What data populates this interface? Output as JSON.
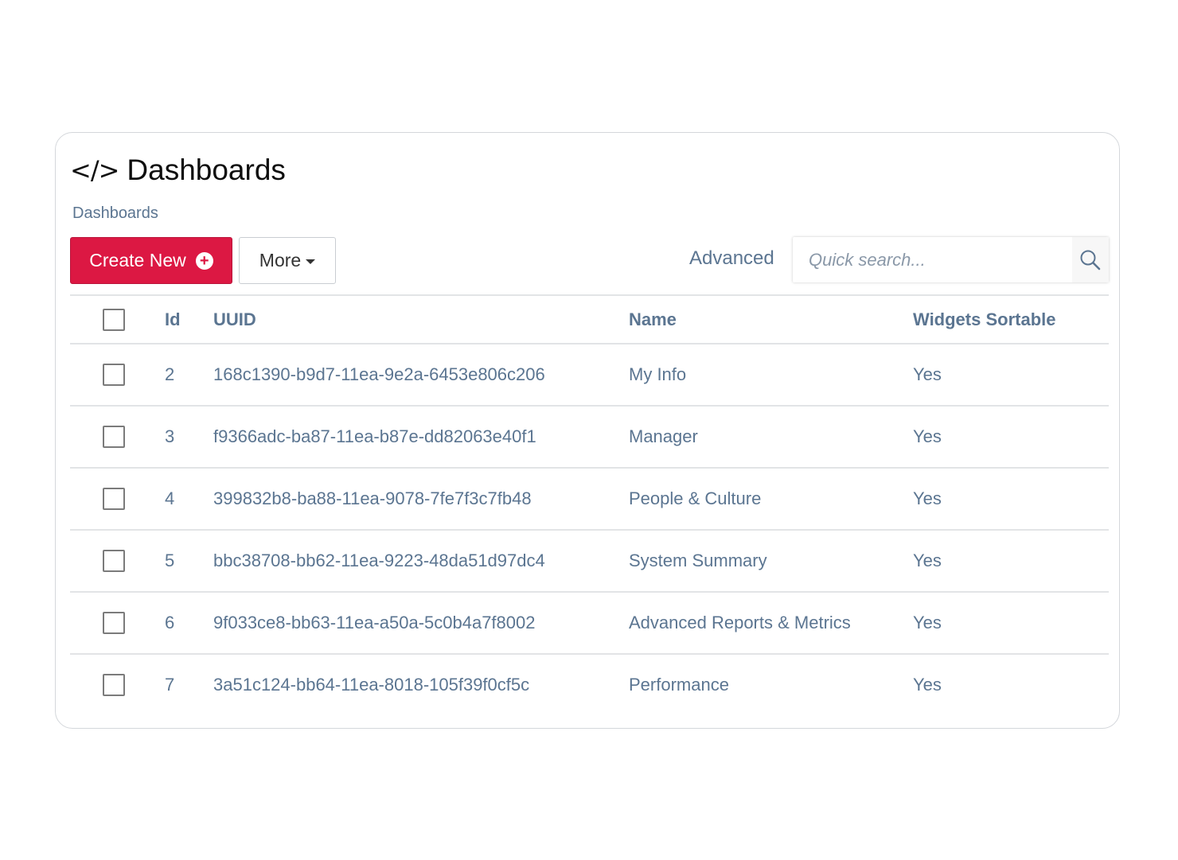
{
  "page": {
    "title": "Dashboards",
    "title_icon": "code-icon",
    "breadcrumb": "Dashboards"
  },
  "toolbar": {
    "create_label": "Create New",
    "create_icon": "plus-circle-icon",
    "more_label": "More",
    "advanced_label": "Advanced",
    "search_placeholder": "Quick search...",
    "search_value": ""
  },
  "colors": {
    "accent": "#dc1843",
    "text": "#5b7591"
  },
  "table": {
    "columns": [
      "Id",
      "UUID",
      "Name",
      "Widgets Sortable"
    ],
    "rows": [
      {
        "id": "2",
        "uuid": "168c1390-b9d7-11ea-9e2a-6453e806c206",
        "name": "My Info",
        "widgets_sortable": "Yes",
        "checked": false
      },
      {
        "id": "3",
        "uuid": "f9366adc-ba87-11ea-b87e-dd82063e40f1",
        "name": "Manager",
        "widgets_sortable": "Yes",
        "checked": false
      },
      {
        "id": "4",
        "uuid": "399832b8-ba88-11ea-9078-7fe7f3c7fb48",
        "name": "People & Culture",
        "widgets_sortable": "Yes",
        "checked": false
      },
      {
        "id": "5",
        "uuid": "bbc38708-bb62-11ea-9223-48da51d97dc4",
        "name": "System Summary",
        "widgets_sortable": "Yes",
        "checked": false
      },
      {
        "id": "6",
        "uuid": "9f033ce8-bb63-11ea-a50a-5c0b4a7f8002",
        "name": "Advanced Reports & Metrics",
        "widgets_sortable": "Yes",
        "checked": false
      },
      {
        "id": "7",
        "uuid": "3a51c124-bb64-11ea-8018-105f39f0cf5c",
        "name": "Performance",
        "widgets_sortable": "Yes",
        "checked": false
      }
    ]
  }
}
